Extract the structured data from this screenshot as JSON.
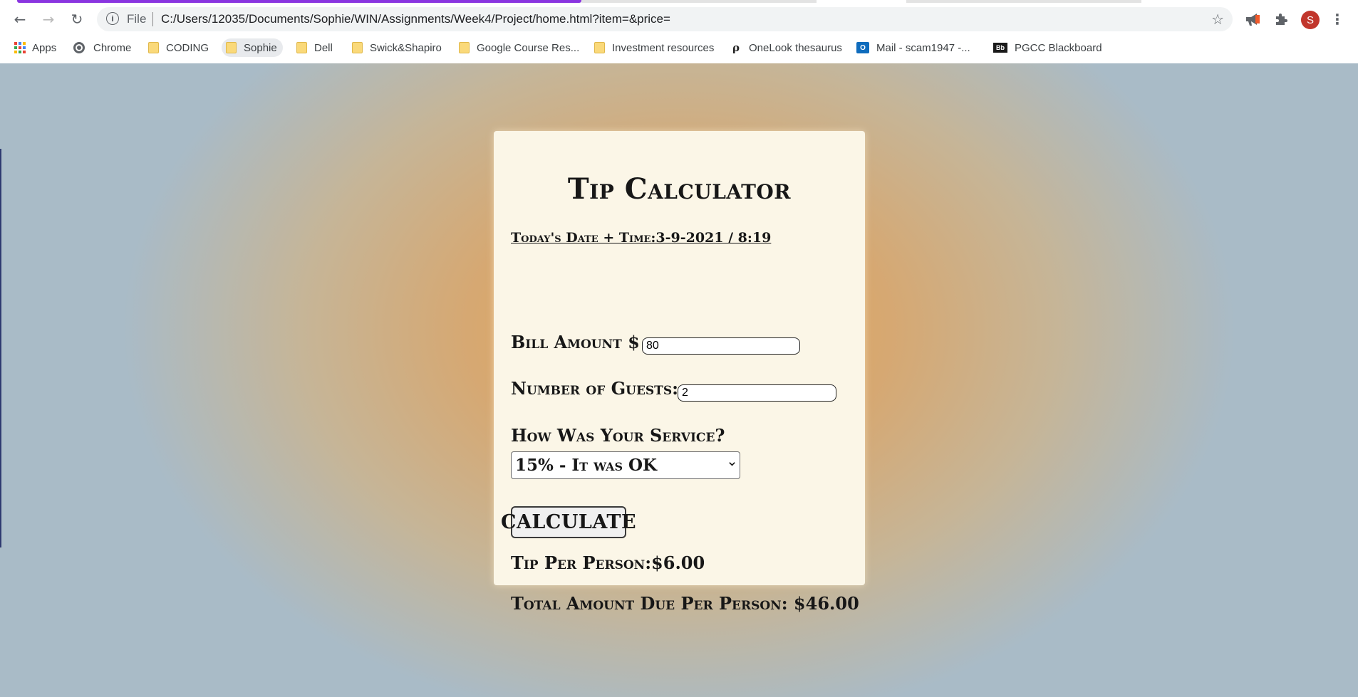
{
  "browser": {
    "url_scheme": "File",
    "url": "C:/Users/12035/Documents/Sophie/WIN/Assignments/Week4/Project/home.html?item=&price=",
    "profile_initial": "S",
    "bookmarks": [
      {
        "label": "Apps",
        "icon": "apps-grid-icon"
      },
      {
        "label": "Chrome",
        "icon": "globe-icon"
      },
      {
        "label": "CODING",
        "icon": "folder-icon"
      },
      {
        "label": "Sophie",
        "icon": "folder-icon"
      },
      {
        "label": "Dell",
        "icon": "folder-icon"
      },
      {
        "label": "Swick&Shapiro",
        "icon": "folder-icon"
      },
      {
        "label": "Google Course Res...",
        "icon": "folder-icon"
      },
      {
        "label": "Investment resources",
        "icon": "folder-icon"
      },
      {
        "label": "OneLook thesaurus",
        "icon": "onelook-icon"
      },
      {
        "label": "Mail - scam1947 -...",
        "icon": "outlook-mail-icon"
      },
      {
        "label": "PGCC Blackboard",
        "icon": "blackboard-icon"
      }
    ]
  },
  "calculator": {
    "title": "Tip Calculator",
    "datetime": "Today's Date + Time:3-9-2021 / 8:19",
    "bill_label": "Bill Amount $",
    "bill_value": "80",
    "guests_label": "Number of Guests:",
    "guests_value": "2",
    "service_label": "How Was Your Service?",
    "service_selected": "15% - It was OK",
    "calculate_label": "CALCULATE",
    "tip_result": "Tip Per Person:$6.00",
    "total_result": "Total Amount Due Per Person: $46.00"
  },
  "colors": {
    "card_background": "#fbf6e7",
    "background_center": "#e7a552",
    "background_edge": "#a9bbc7",
    "loading_bar": "#8a35e0",
    "avatar": "#c1362c"
  }
}
